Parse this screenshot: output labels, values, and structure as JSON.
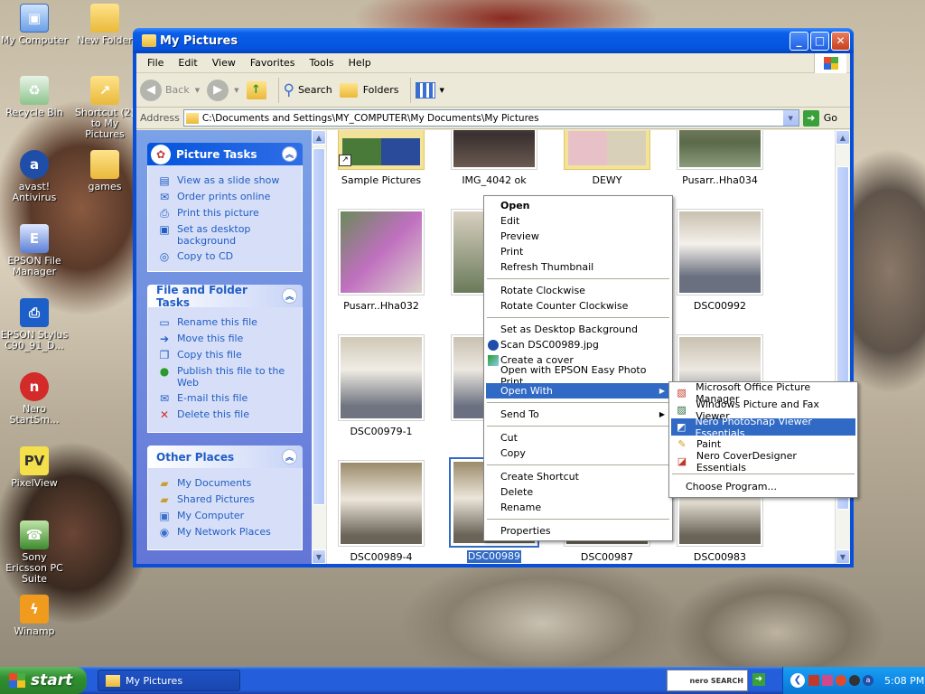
{
  "desktop_icons": [
    {
      "label": "My Computer",
      "icon": "computer-icon"
    },
    {
      "label": "New Folder",
      "icon": "folder-icon"
    },
    {
      "label": "Recycle Bin",
      "icon": "recycle-bin-icon"
    },
    {
      "label": "Shortcut (2) to My Pictures",
      "icon": "folder-shortcut-icon"
    },
    {
      "label": "avast! Antivirus",
      "icon": "avast-icon"
    },
    {
      "label": "games",
      "icon": "folder-icon"
    },
    {
      "label": "EPSON File Manager",
      "icon": "epson-icon"
    },
    {
      "label": "EPSON Stylus C90_91_D...",
      "icon": "printer-icon"
    },
    {
      "label": "Nero StartSm...",
      "icon": "nero-icon"
    },
    {
      "label": "PixelView",
      "icon": "pixelview-icon"
    },
    {
      "label": "Sony Ericsson PC Suite",
      "icon": "phone-icon"
    },
    {
      "label": "Winamp",
      "icon": "winamp-icon"
    }
  ],
  "window": {
    "title": "My Pictures",
    "menu": [
      "File",
      "Edit",
      "View",
      "Favorites",
      "Tools",
      "Help"
    ],
    "toolbar": {
      "back": "Back",
      "search": "Search",
      "folders": "Folders"
    },
    "address": {
      "label": "Address",
      "path": "C:\\Documents and Settings\\MY_COMPUTER\\My Documents\\My Pictures",
      "go": "Go"
    }
  },
  "tasks": {
    "picture_tasks": {
      "title": "Picture Tasks",
      "items": [
        "View as a slide show",
        "Order prints online",
        "Print this picture",
        "Set as desktop background",
        "Copy to CD"
      ]
    },
    "file_tasks": {
      "title": "File and Folder Tasks",
      "items": [
        "Rename this file",
        "Move this file",
        "Copy this file",
        "Publish this file to the Web",
        "E-mail this file",
        "Delete this file"
      ]
    },
    "other_places": {
      "title": "Other Places",
      "items": [
        "My Documents",
        "Shared Pictures",
        "My Computer",
        "My Network Places"
      ]
    }
  },
  "files": {
    "row1": [
      "Sample Pictures",
      "IMG_4042 ok",
      "DEWY",
      "Pusarr..Hha034"
    ],
    "row2": [
      "Pusarr..Hha032",
      "Pusa",
      "DSC00992"
    ],
    "row3": [
      "DSC00979-1",
      "DS"
    ],
    "row4": [
      "DSC00989-4",
      "DSC00989",
      "DSC00987",
      "DSC00983"
    ]
  },
  "context_menu": {
    "items": [
      "Open",
      "Edit",
      "Preview",
      "Print",
      "Refresh Thumbnail",
      "Rotate Clockwise",
      "Rotate Counter Clockwise",
      "Set as Desktop Background",
      "Scan DSC00989.jpg",
      "Create a cover",
      "Open with EPSON Easy Photo Print",
      "Open With",
      "Send To",
      "Cut",
      "Copy",
      "Create Shortcut",
      "Delete",
      "Rename",
      "Properties"
    ]
  },
  "open_with": {
    "items": [
      "Microsoft Office Picture Manager",
      "Windows Picture and Fax Viewer",
      "Nero PhotoSnap Viewer Essentials",
      "Paint",
      "Nero CoverDesigner Essentials"
    ],
    "choose": "Choose Program..."
  },
  "taskbar": {
    "start": "start",
    "task_button": "My Pictures",
    "search_brand": "nero SEARCH",
    "clock": "5:08 PM"
  },
  "colors": {
    "xp_blue": "#0a4fd8",
    "highlight": "#316ac5",
    "task_link": "#215dc6"
  }
}
